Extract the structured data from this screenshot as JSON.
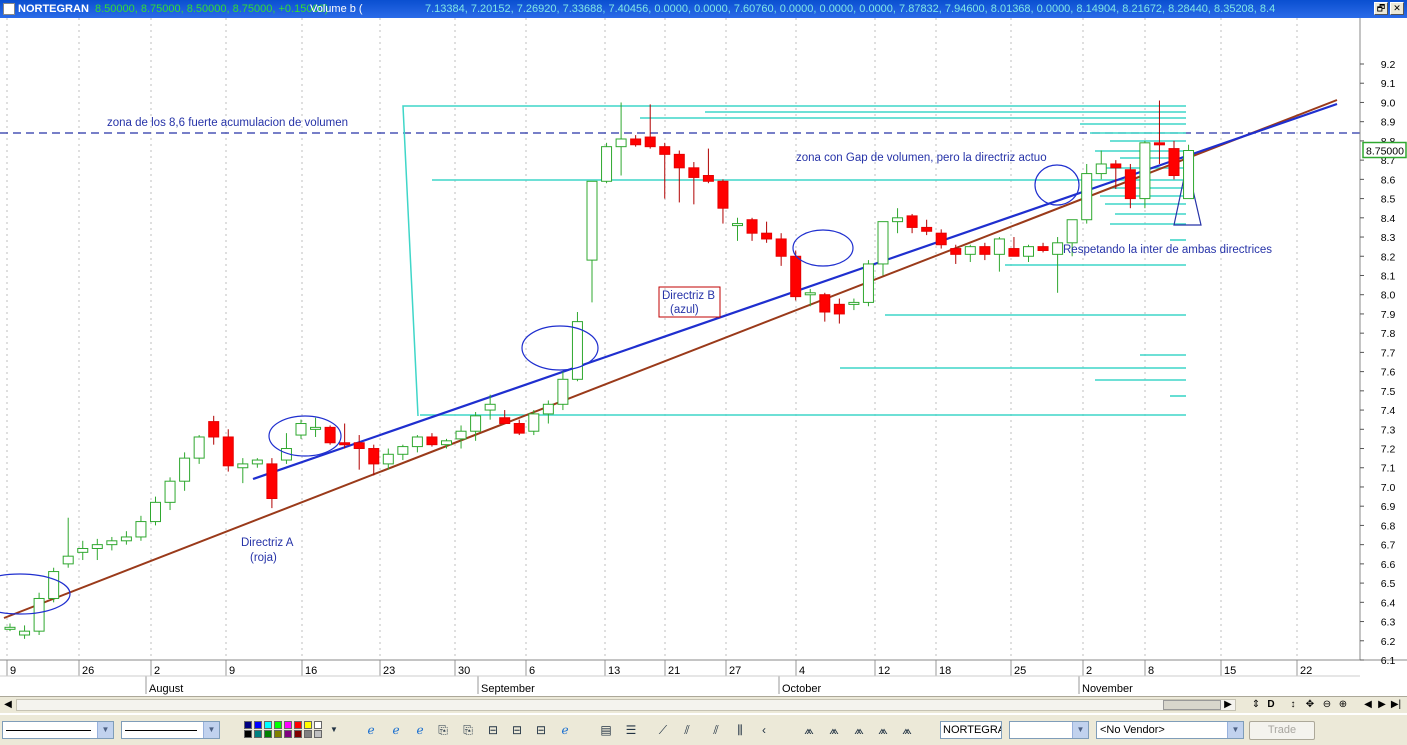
{
  "window": {
    "ticker": "NORTEGRAN",
    "ohlc_text": "8.50000, 8.75000, 8.50000, 8.75000, +0.15000)",
    "volume_label": "Volume b (",
    "volume_values": "7.13384, 7.20152, 7.26920, 7.33688, 7.40456, 0.0000, 0.0000, 7.60760, 0.0000, 0.0000, 0.0000, 7.87832, 7.94600, 8.01368, 0.0000, 8.14904, 8.21672, 8.28440, 8.35208, 8.4",
    "restore_glyph": "🗗",
    "close_glyph": "✕"
  },
  "chart_data": {
    "type": "candlestick",
    "price_label": "8.75000",
    "ylim": [
      6.0,
      9.3
    ],
    "y_ticks": [
      "6.1",
      "6.2",
      "6.3",
      "6.4",
      "6.5",
      "6.6",
      "6.7",
      "6.8",
      "6.9",
      "7.0",
      "7.1",
      "7.2",
      "7.3",
      "7.4",
      "7.5",
      "7.6",
      "7.7",
      "7.8",
      "7.9",
      "8.0",
      "8.1",
      "8.2",
      "8.3",
      "8.4",
      "8.5",
      "8.6",
      "8.7",
      "8.8",
      "8.9",
      "9.0",
      "9.1",
      "9.2"
    ],
    "x_day_labels": [
      "9",
      "26",
      "2",
      "9",
      "16",
      "23",
      "30",
      "6",
      "13",
      "21",
      "27",
      "4",
      "12",
      "18",
      "25",
      "2",
      "8",
      "15",
      "22"
    ],
    "x_month_labels": [
      "August",
      "September",
      "October",
      "November"
    ],
    "candles": [
      {
        "o": 6.27,
        "h": 6.29,
        "l": 6.25,
        "c": 6.27
      },
      {
        "o": 6.23,
        "h": 6.28,
        "l": 6.21,
        "c": 6.25
      },
      {
        "o": 6.25,
        "h": 6.45,
        "l": 6.23,
        "c": 6.42
      },
      {
        "o": 6.42,
        "h": 6.58,
        "l": 6.4,
        "c": 6.56
      },
      {
        "o": 6.6,
        "h": 6.84,
        "l": 6.58,
        "c": 6.64
      },
      {
        "o": 6.66,
        "h": 6.72,
        "l": 6.62,
        "c": 6.68
      },
      {
        "o": 6.68,
        "h": 6.73,
        "l": 6.62,
        "c": 6.7
      },
      {
        "o": 6.7,
        "h": 6.74,
        "l": 6.67,
        "c": 6.72
      },
      {
        "o": 6.72,
        "h": 6.77,
        "l": 6.7,
        "c": 6.74
      },
      {
        "o": 6.74,
        "h": 6.85,
        "l": 6.72,
        "c": 6.82
      },
      {
        "o": 6.82,
        "h": 6.95,
        "l": 6.8,
        "c": 6.92
      },
      {
        "o": 6.92,
        "h": 7.05,
        "l": 6.88,
        "c": 7.03
      },
      {
        "o": 7.03,
        "h": 7.18,
        "l": 6.98,
        "c": 7.15
      },
      {
        "o": 7.15,
        "h": 7.27,
        "l": 7.12,
        "c": 7.26
      },
      {
        "o": 7.34,
        "h": 7.37,
        "l": 7.22,
        "c": 7.26
      },
      {
        "o": 7.26,
        "h": 7.3,
        "l": 7.08,
        "c": 7.11
      },
      {
        "o": 7.1,
        "h": 7.15,
        "l": 7.02,
        "c": 7.12
      },
      {
        "o": 7.12,
        "h": 7.15,
        "l": 7.1,
        "c": 7.14
      },
      {
        "o": 7.12,
        "h": 7.15,
        "l": 6.89,
        "c": 6.94
      },
      {
        "o": 7.14,
        "h": 7.28,
        "l": 7.12,
        "c": 7.2
      },
      {
        "o": 7.27,
        "h": 7.35,
        "l": 7.25,
        "c": 7.33
      },
      {
        "o": 7.3,
        "h": 7.36,
        "l": 7.26,
        "c": 7.31
      },
      {
        "o": 7.31,
        "h": 7.32,
        "l": 7.22,
        "c": 7.23
      },
      {
        "o": 7.23,
        "h": 7.33,
        "l": 7.2,
        "c": 7.22
      },
      {
        "o": 7.23,
        "h": 7.27,
        "l": 7.09,
        "c": 7.2
      },
      {
        "o": 7.2,
        "h": 7.22,
        "l": 7.06,
        "c": 7.12
      },
      {
        "o": 7.12,
        "h": 7.2,
        "l": 7.09,
        "c": 7.17
      },
      {
        "o": 7.17,
        "h": 7.22,
        "l": 7.14,
        "c": 7.21
      },
      {
        "o": 7.21,
        "h": 7.27,
        "l": 7.18,
        "c": 7.26
      },
      {
        "o": 7.26,
        "h": 7.28,
        "l": 7.21,
        "c": 7.22
      },
      {
        "o": 7.22,
        "h": 7.25,
        "l": 7.2,
        "c": 7.24
      },
      {
        "o": 7.25,
        "h": 7.32,
        "l": 7.2,
        "c": 7.29
      },
      {
        "o": 7.29,
        "h": 7.39,
        "l": 7.24,
        "c": 7.37
      },
      {
        "o": 7.4,
        "h": 7.48,
        "l": 7.35,
        "c": 7.43
      },
      {
        "o": 7.36,
        "h": 7.4,
        "l": 7.33,
        "c": 7.33
      },
      {
        "o": 7.33,
        "h": 7.35,
        "l": 7.27,
        "c": 7.28
      },
      {
        "o": 7.29,
        "h": 7.4,
        "l": 7.27,
        "c": 7.38
      },
      {
        "o": 7.38,
        "h": 7.45,
        "l": 7.33,
        "c": 7.43
      },
      {
        "o": 7.43,
        "h": 7.6,
        "l": 7.4,
        "c": 7.56
      },
      {
        "o": 7.56,
        "h": 7.91,
        "l": 7.55,
        "c": 7.86
      },
      {
        "o": 8.18,
        "h": 8.26,
        "l": 7.96,
        "c": 8.59
      },
      {
        "o": 8.59,
        "h": 8.79,
        "l": 8.58,
        "c": 8.77
      },
      {
        "o": 8.77,
        "h": 9.0,
        "l": 8.62,
        "c": 8.81
      },
      {
        "o": 8.81,
        "h": 8.83,
        "l": 8.77,
        "c": 8.78
      },
      {
        "o": 8.82,
        "h": 8.99,
        "l": 8.76,
        "c": 8.77
      },
      {
        "o": 8.77,
        "h": 8.79,
        "l": 8.5,
        "c": 8.73
      },
      {
        "o": 8.73,
        "h": 8.75,
        "l": 8.48,
        "c": 8.66
      },
      {
        "o": 8.66,
        "h": 8.69,
        "l": 8.47,
        "c": 8.61
      },
      {
        "o": 8.62,
        "h": 8.76,
        "l": 8.58,
        "c": 8.59
      },
      {
        "o": 8.59,
        "h": 8.6,
        "l": 8.37,
        "c": 8.45
      },
      {
        "o": 8.37,
        "h": 8.4,
        "l": 8.28,
        "c": 8.37
      },
      {
        "o": 8.39,
        "h": 8.4,
        "l": 8.28,
        "c": 8.32
      },
      {
        "o": 8.32,
        "h": 8.38,
        "l": 8.27,
        "c": 8.29
      },
      {
        "o": 8.29,
        "h": 8.32,
        "l": 8.15,
        "c": 8.2
      },
      {
        "o": 8.2,
        "h": 8.23,
        "l": 7.97,
        "c": 7.99
      },
      {
        "o": 8.0,
        "h": 8.03,
        "l": 7.94,
        "c": 8.01
      },
      {
        "o": 8.0,
        "h": 8.01,
        "l": 7.86,
        "c": 7.91
      },
      {
        "o": 7.95,
        "h": 7.98,
        "l": 7.85,
        "c": 7.9
      },
      {
        "o": 7.95,
        "h": 7.98,
        "l": 7.92,
        "c": 7.96
      },
      {
        "o": 7.96,
        "h": 8.18,
        "l": 7.94,
        "c": 8.16
      },
      {
        "o": 8.16,
        "h": 8.35,
        "l": 8.1,
        "c": 8.38
      },
      {
        "o": 8.38,
        "h": 8.45,
        "l": 8.32,
        "c": 8.4
      },
      {
        "o": 8.41,
        "h": 8.42,
        "l": 8.32,
        "c": 8.35
      },
      {
        "o": 8.35,
        "h": 8.39,
        "l": 8.31,
        "c": 8.33
      },
      {
        "o": 8.32,
        "h": 8.34,
        "l": 8.24,
        "c": 8.26
      },
      {
        "o": 8.24,
        "h": 8.26,
        "l": 8.16,
        "c": 8.21
      },
      {
        "o": 8.21,
        "h": 8.26,
        "l": 8.17,
        "c": 8.25
      },
      {
        "o": 8.25,
        "h": 8.27,
        "l": 8.18,
        "c": 8.21
      },
      {
        "o": 8.21,
        "h": 8.3,
        "l": 8.12,
        "c": 8.29
      },
      {
        "o": 8.24,
        "h": 8.3,
        "l": 8.21,
        "c": 8.2
      },
      {
        "o": 8.2,
        "h": 8.26,
        "l": 8.17,
        "c": 8.25
      },
      {
        "o": 8.25,
        "h": 8.27,
        "l": 8.22,
        "c": 8.23
      },
      {
        "o": 8.21,
        "h": 8.3,
        "l": 8.01,
        "c": 8.27
      },
      {
        "o": 8.27,
        "h": 8.38,
        "l": 8.2,
        "c": 8.39
      },
      {
        "o": 8.39,
        "h": 8.68,
        "l": 8.37,
        "c": 8.63
      },
      {
        "o": 8.63,
        "h": 8.75,
        "l": 8.6,
        "c": 8.68
      },
      {
        "o": 8.68,
        "h": 8.7,
        "l": 8.55,
        "c": 8.66
      },
      {
        "o": 8.65,
        "h": 8.68,
        "l": 8.45,
        "c": 8.5
      },
      {
        "o": 8.5,
        "h": 8.8,
        "l": 8.45,
        "c": 8.79
      },
      {
        "o": 8.79,
        "h": 9.01,
        "l": 8.68,
        "c": 8.78
      },
      {
        "o": 8.76,
        "h": 8.8,
        "l": 8.6,
        "c": 8.62
      },
      {
        "o": 8.5,
        "h": 8.78,
        "l": 8.5,
        "c": 8.75
      }
    ],
    "annotations": {
      "zona_86": "zona de los 8,6 fuerte acumulacion de volumen",
      "gap_zone": "zona con Gap de volumen, pero la directriz actuo",
      "respetando": "Respetando la inter de ambas directrices",
      "directriz_a_1": "Directriz A",
      "directriz_a_2": "(roja)",
      "directriz_b_1": "Directriz B",
      "directriz_b_2": "(azul)"
    }
  },
  "toolbar": {
    "ticker_value": "NORTEGRAN",
    "vendor_value": "<No Vendor>",
    "trade_label": "Trade",
    "d_label": "D",
    "swatch_colors": [
      "#000080",
      "#0000ff",
      "#00ffff",
      "#00ff00",
      "#ff00ff",
      "#ff0000",
      "#ffff00",
      "#ffffff",
      "#000000",
      "#008080",
      "#008000",
      "#808000",
      "#800080",
      "#800000",
      "#808080",
      "#c0c0c0"
    ]
  }
}
